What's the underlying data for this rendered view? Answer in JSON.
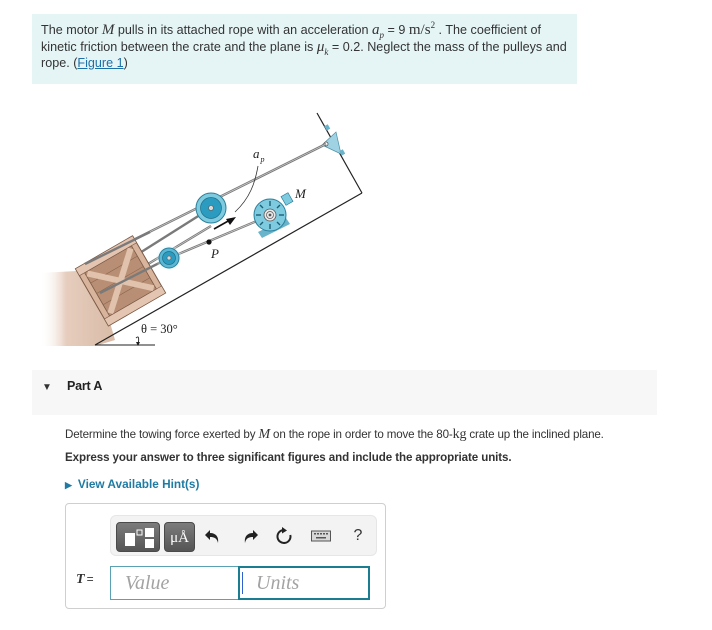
{
  "problem": {
    "text_parts": {
      "p1": "The motor ",
      "motor_symbol": "M",
      "p2": " pulls in its attached rope with an acceleration ",
      "accel_symbol": "a",
      "accel_sub": "p",
      "p3": " = 9 ",
      "accel_unit": "m/s",
      "accel_unit_exp": "2",
      "p4": " . The coefficient of kinetic friction between the crate and the plane is ",
      "mu_symbol": "μ",
      "mu_sub": "k",
      "p5": " = 0.2. Neglect the mass of the pulleys and rope. (",
      "figure_link": "Figure 1",
      "p6": ")"
    }
  },
  "figure": {
    "label_accel": "a",
    "label_accel_sub": "p",
    "label_motor": "M",
    "label_point": "P",
    "label_angle": "θ = 30°",
    "colors": {
      "pulley": "#2b9bbf",
      "pulley_light": "#8fd0e4",
      "crate": "#c9a48a",
      "crate_dark": "#8c6b55",
      "ground": "#e2c9b8",
      "rope": "#6a6a6a"
    }
  },
  "part": {
    "title": "Part A",
    "toggle_icon": "▼",
    "question": {
      "q1": "Determine the towing force exerted by ",
      "q_symbol": "M",
      "q2": " on the rope in order to move the 80-",
      "q_unit": "kg",
      "q3": " crate up the inclined plane."
    },
    "instruction": "Express your answer to three significant figures and include the appropriate units.",
    "hint_label": "View Available Hint(s)",
    "hint_icon": "▶"
  },
  "answer": {
    "toolbar": {
      "templates_icon": "templates-icon",
      "units_label": "μÅ",
      "undo_icon": "undo-icon",
      "redo_icon": "redo-icon",
      "reset_icon": "reset-icon",
      "keyboard_icon": "keyboard-icon",
      "help_label": "?"
    },
    "variable": "T",
    "equals": "=",
    "value_placeholder": "Value",
    "units_placeholder": "Units",
    "value": "",
    "units": ""
  },
  "colors": {
    "intro_bg": "#e5f5f6",
    "link": "#1e6fa8",
    "hint": "#1f7ba3",
    "part_header_bg": "#f7f7f7",
    "input_border": "#5aa2b3",
    "input_focus_border": "#1a7d92"
  }
}
